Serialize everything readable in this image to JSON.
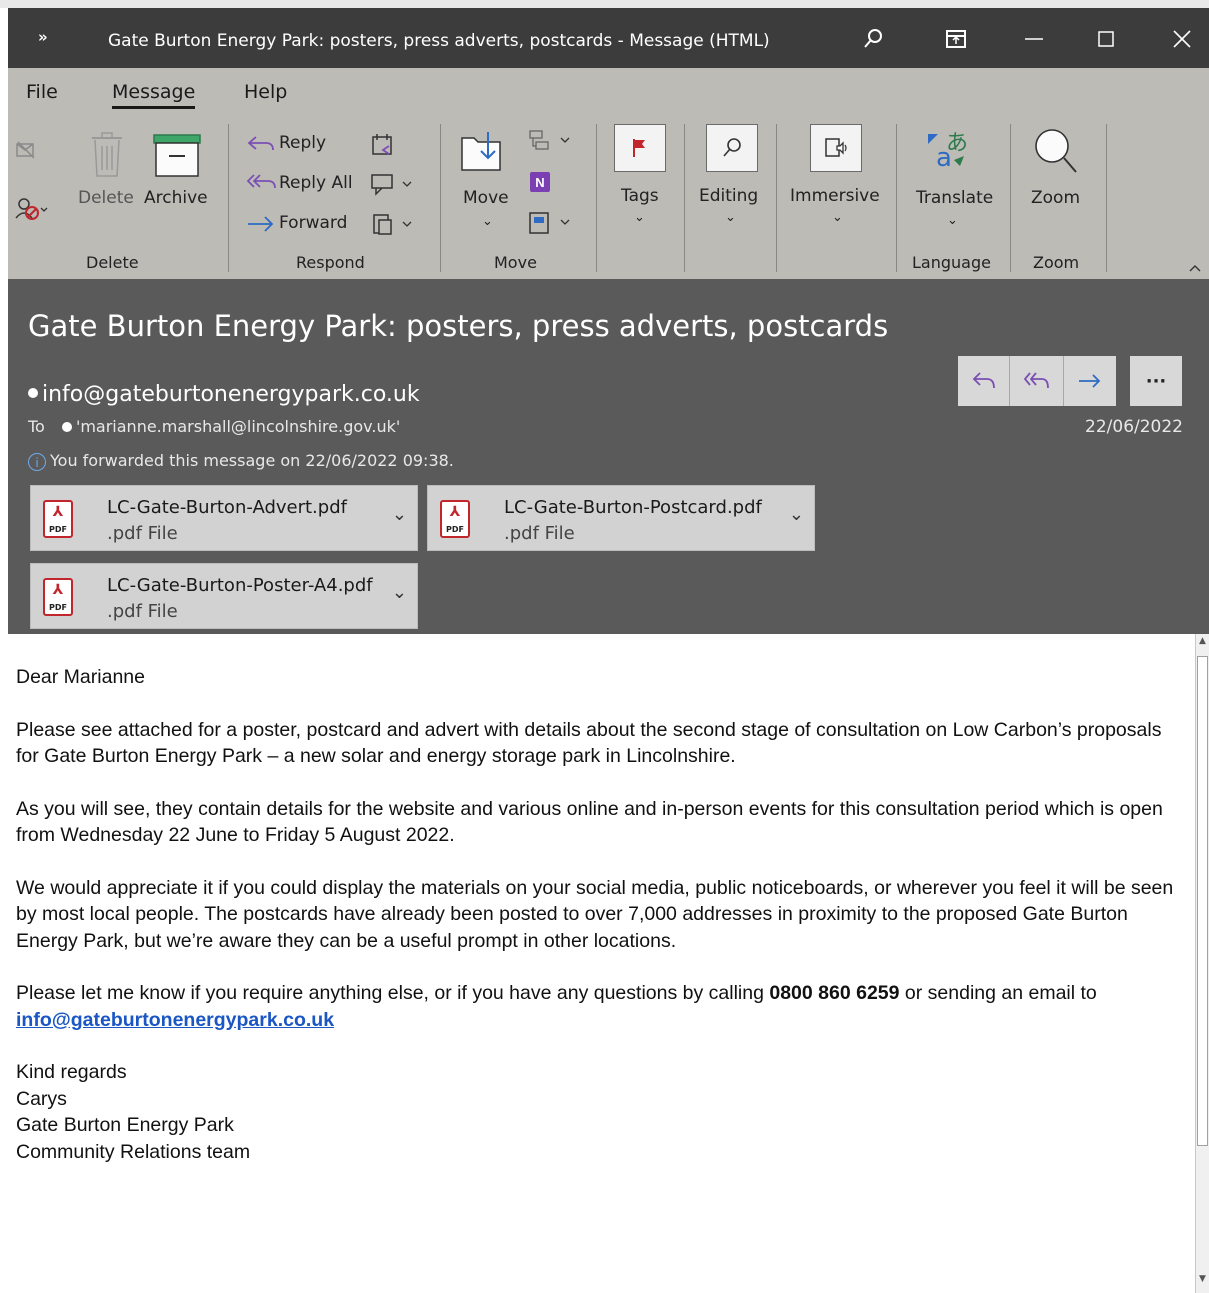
{
  "window": {
    "title": "Gate Burton Energy Park: posters, press adverts, postcards  - Message (HTML)",
    "expand_glyph": "»"
  },
  "menu": {
    "items": [
      {
        "label": "File"
      },
      {
        "label": "Message"
      },
      {
        "label": "Help"
      }
    ]
  },
  "ribbon": {
    "delete_label": "Delete",
    "archive_label": "Archive",
    "reply_label": "Reply",
    "reply_all_label": "Reply All",
    "forward_label": "Forward",
    "move_label": "Move",
    "tags_label": "Tags",
    "editing_label": "Editing",
    "immersive_label": "Immersive",
    "translate_label": "Translate",
    "zoom_label": "Zoom",
    "groups": {
      "delete": "Delete",
      "respond": "Respond",
      "move": "Move",
      "language": "Language",
      "zoom": "Zoom"
    }
  },
  "message": {
    "subject": "Gate Burton Energy Park: posters, press adverts, postcards",
    "from": "info@gateburtonenergypark.co.uk",
    "to_label": "To",
    "to": "'marianne.marshall@lincolnshire.gov.uk'",
    "info": "You forwarded this message on 22/06/2022 09:38.",
    "date": "22/06/2022",
    "more_glyph": "···"
  },
  "attachments": [
    {
      "name": "LC-Gate-Burton-Advert.pdf",
      "type": ".pdf File"
    },
    {
      "name": "LC-Gate-Burton-Postcard.pdf",
      "type": ".pdf File"
    },
    {
      "name": "LC-Gate-Burton-Poster-A4.pdf",
      "type": ".pdf File"
    }
  ],
  "body": {
    "greeting": "Dear Marianne",
    "p1": "Please see attached for a poster, postcard and advert with details about the second stage of consultation on Low Carbon’s proposals for Gate Burton Energy Park – a new solar and energy storage park in Lincolnshire.",
    "p2": "As you will see, they contain details for the website and various online and in-person events for this consultation period which is open from Wednesday 22 June to Friday 5 August 2022.",
    "p3": "We would appreciate it if you could display the materials on your social media, public noticeboards, or wherever you feel it will be seen by most local people. The postcards have already been posted to over 7,000 addresses in proximity to the proposed Gate Burton Energy Park, but we’re aware they can be a useful prompt in other locations.",
    "p4_prefix": "Please let me know if you require anything else, or if you have any questions by calling ",
    "phone": "0800 860 6259",
    "p4_mid": " or sending an email to ",
    "email_link": "info@gateburtonenergypark.co.uk",
    "sign_off": "Kind regards",
    "sig_name": "Carys",
    "sig_org": "Gate Burton Energy Park",
    "sig_team": "Community Relations team"
  }
}
